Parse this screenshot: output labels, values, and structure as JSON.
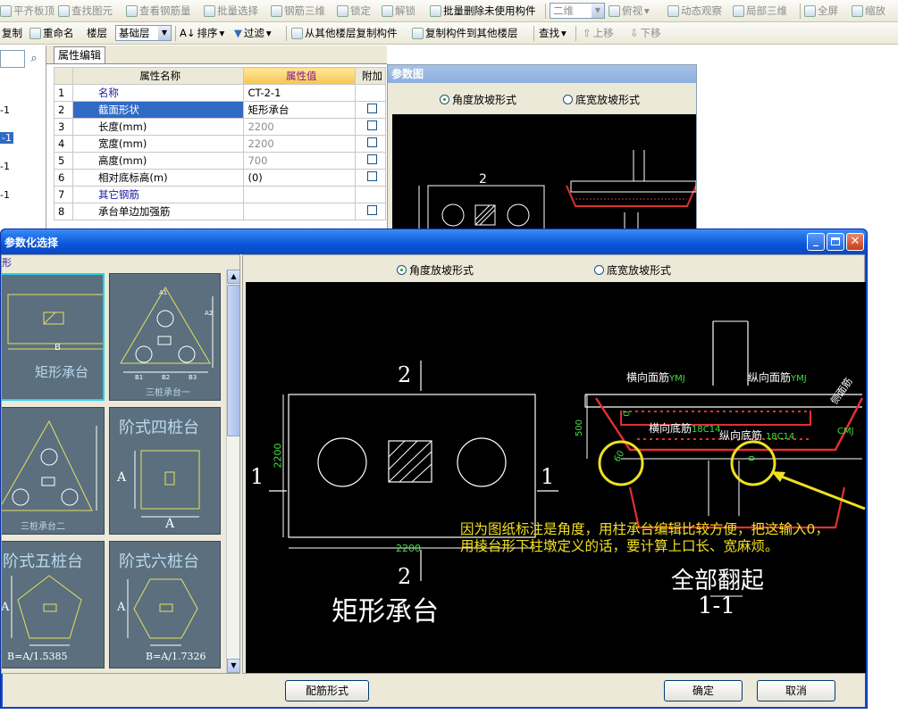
{
  "toolbar1": {
    "items": [
      "平齐板顶",
      "查找图元",
      "查看钢筋量",
      "批量选择",
      "钢筋三维",
      "锁定",
      "解锁",
      "批量删除未使用构件",
      "二维",
      "俯视",
      "动态观察",
      "局部三维",
      "全屏",
      "缩放"
    ]
  },
  "toolbar2": {
    "copy": "复制",
    "rename": "重命名",
    "floor_label": "楼层",
    "floor_value": "基础层",
    "sort": "排序",
    "filter": "过滤",
    "copy_from_floor": "从其他楼层复制构件",
    "copy_to_floor": "复制构件到其他楼层",
    "find": "查找",
    "move_up": "上移",
    "move_down": "下移"
  },
  "left_tree": {
    "items": [
      "-1",
      "-1",
      "-1",
      "-1"
    ]
  },
  "property_panel": {
    "tab": "属性编辑",
    "headers": {
      "name": "属性名称",
      "value": "属性值",
      "extra": "附加"
    },
    "rows": [
      {
        "no": "1",
        "name": "名称",
        "value": "CT-2-1",
        "check": false
      },
      {
        "no": "2",
        "name": "截面形状",
        "value": "矩形承台",
        "check": true
      },
      {
        "no": "3",
        "name": "长度(mm)",
        "value": "2200",
        "check": true
      },
      {
        "no": "4",
        "name": "宽度(mm)",
        "value": "2200",
        "check": true
      },
      {
        "no": "5",
        "name": "高度(mm)",
        "value": "700",
        "check": true
      },
      {
        "no": "6",
        "name": "相对底标高(m)",
        "value": "(0)",
        "check": true
      },
      {
        "no": "7",
        "name": "其它钢筋",
        "value": "",
        "check": false
      },
      {
        "no": "8",
        "name": "承台单边加强筋",
        "value": "",
        "check": true
      }
    ]
  },
  "ref_panel": {
    "title": "参数图",
    "radio1": "角度放坡形式",
    "radio2": "底宽放坡形式",
    "section_mark": "2"
  },
  "dialog": {
    "title": "参数化选择",
    "left_header": "形",
    "radio1": "角度放坡形式",
    "radio2": "底宽放坡形式",
    "thumbs": [
      {
        "label": "矩形承台",
        "dim": "B"
      },
      {
        "label": "三桩承台一",
        "dims": [
          "A1",
          "A2",
          "B1",
          "B2",
          "B3"
        ]
      },
      {
        "label": "三桩承台二",
        "dims": []
      },
      {
        "label": "阶式四桩台",
        "dims": [
          "A",
          "A"
        ]
      },
      {
        "label": "阶式五桩台",
        "dims": [
          "A",
          "B=A/1.5385"
        ]
      },
      {
        "label": "阶式六桩台",
        "dims": [
          "A",
          "B=A/1.7326"
        ]
      }
    ],
    "drawing": {
      "plan_title": "矩形承台",
      "section_mark_top": "2",
      "section_mark_bottom": "2",
      "section_mark_left": "1",
      "section_mark_right": "1",
      "dim_width": "2200",
      "dim_height": "2200",
      "sec_top_h": "横向面筋",
      "sec_top_h_code": "YMJ",
      "sec_top_v": "纵向面筋",
      "sec_top_v_code": "YMJ",
      "sec_side": "侧面筋",
      "sec_bot_h": "横向底筋",
      "sec_bot_h_val": "18C14",
      "sec_bot_v": "纵向底筋",
      "sec_bot_v_val": "18C14",
      "sec_cmj": "CMJ",
      "sec_height": "500",
      "sec_angle": "60",
      "sec_zero1": "0",
      "sec_zero2": "0",
      "note1": "因为图纸标注是角度，用柱承台编辑比较方便，把这输入0，",
      "note2": "用棱台形下柱墩定义的话，要计算上口长、宽麻烦。",
      "sec_title": "全部翻起",
      "sec_mark": "1-1"
    },
    "btn_rebar": "配筋形式",
    "btn_ok": "确定",
    "btn_cancel": "取消"
  }
}
